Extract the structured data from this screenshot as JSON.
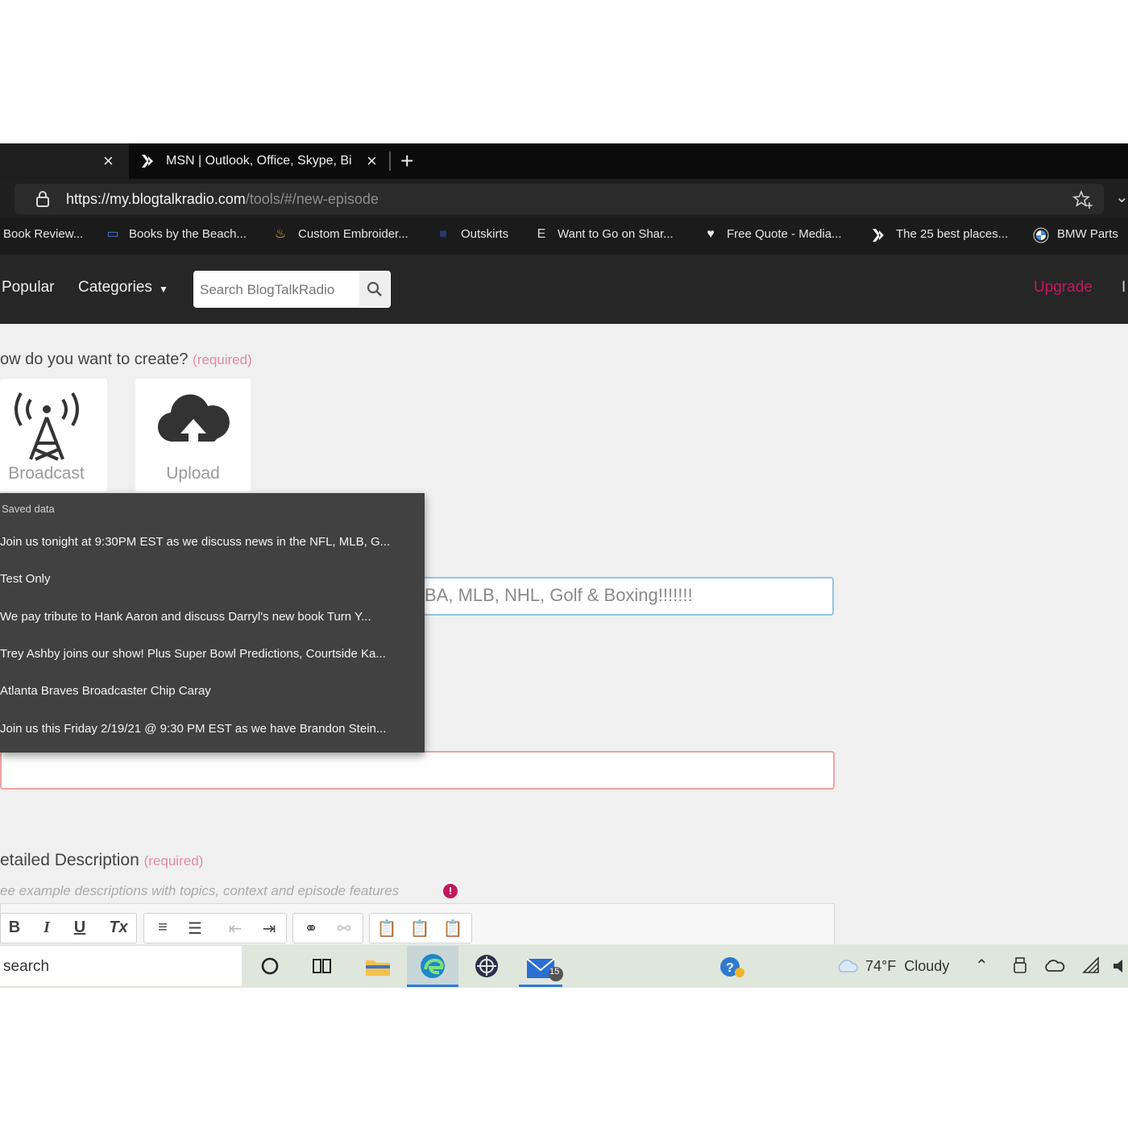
{
  "browser": {
    "tabs": [
      {
        "title": "",
        "active": false
      },
      {
        "title": "MSN | Outlook, Office, Skype, Bi",
        "active": true
      }
    ],
    "new_tab_symbol": "+",
    "close_symbol": "×",
    "url_main": "https://my.blogtalkradio.com",
    "url_rest": "/tools/#/new-episode",
    "favorites": [
      "Book Review...",
      "Books by the Beach...",
      "Custom Embroider...",
      "Outskirts",
      "Want to Go on Shar...",
      "Free Quote - Media...",
      "The 25 best places...",
      "BMW Parts"
    ]
  },
  "site_nav": {
    "popular": "Popular",
    "categories": "Categories",
    "search_placeholder": "Search BlogTalkRadio",
    "upgrade": "Upgrade",
    "upgrade_color": "#c2185b"
  },
  "form": {
    "create_question": "ow do you want to create?",
    "required_label": "(required)",
    "options": [
      {
        "label": "Broadcast",
        "icon": "broadcast-tower-icon"
      },
      {
        "label": "Upload",
        "icon": "cloud-upload-icon"
      }
    ],
    "title_value": "BA, MLB, NHL, Golf & Boxing!!!!!!!",
    "detailed_description_label": "etailed Description",
    "description_hint": "ee example descriptions with topics, context and episode features",
    "toolbar_buttons": [
      "B",
      "I",
      "U",
      "Tx"
    ]
  },
  "autofill": {
    "header": "Saved data",
    "items": [
      "Join us tonight at 9:30PM EST as we discuss news in the NFL, MLB, G...",
      "Test Only",
      "We pay tribute to Hank Aaron and discuss  Darryl's new book Turn Y...",
      "Trey Ashby joins our show! Plus Super Bowl Predictions, Courtside Ka...",
      "Atlanta Braves Broadcaster Chip Caray",
      "Join us this Friday 2/19/21 @ 9:30 PM EST as we have Brandon Stein..."
    ]
  },
  "taskbar": {
    "search_text": "search",
    "weather": "74°F  Cloudy",
    "mail_badge": "15"
  }
}
